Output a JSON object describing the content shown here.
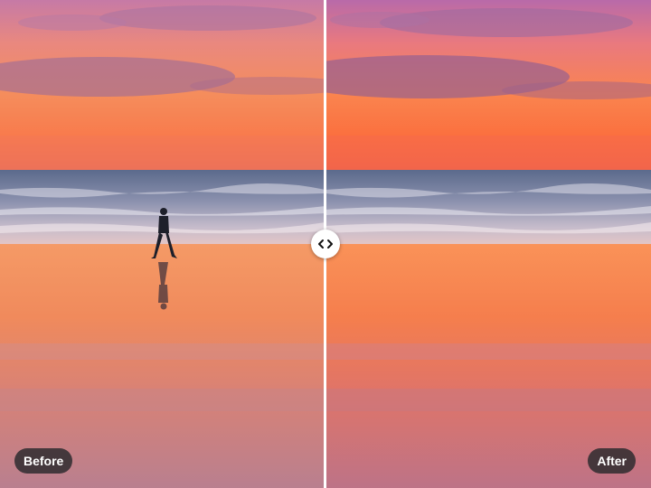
{
  "compare": {
    "before_label": "Before",
    "after_label": "After",
    "divider_position": 0.5
  },
  "icons": {
    "handle": "chevron-left-right-icon"
  },
  "colors": {
    "divider": "#ffffff",
    "handle_bg": "#ffffff",
    "label_bg": "#28282c",
    "label_text": "#ffffff"
  }
}
